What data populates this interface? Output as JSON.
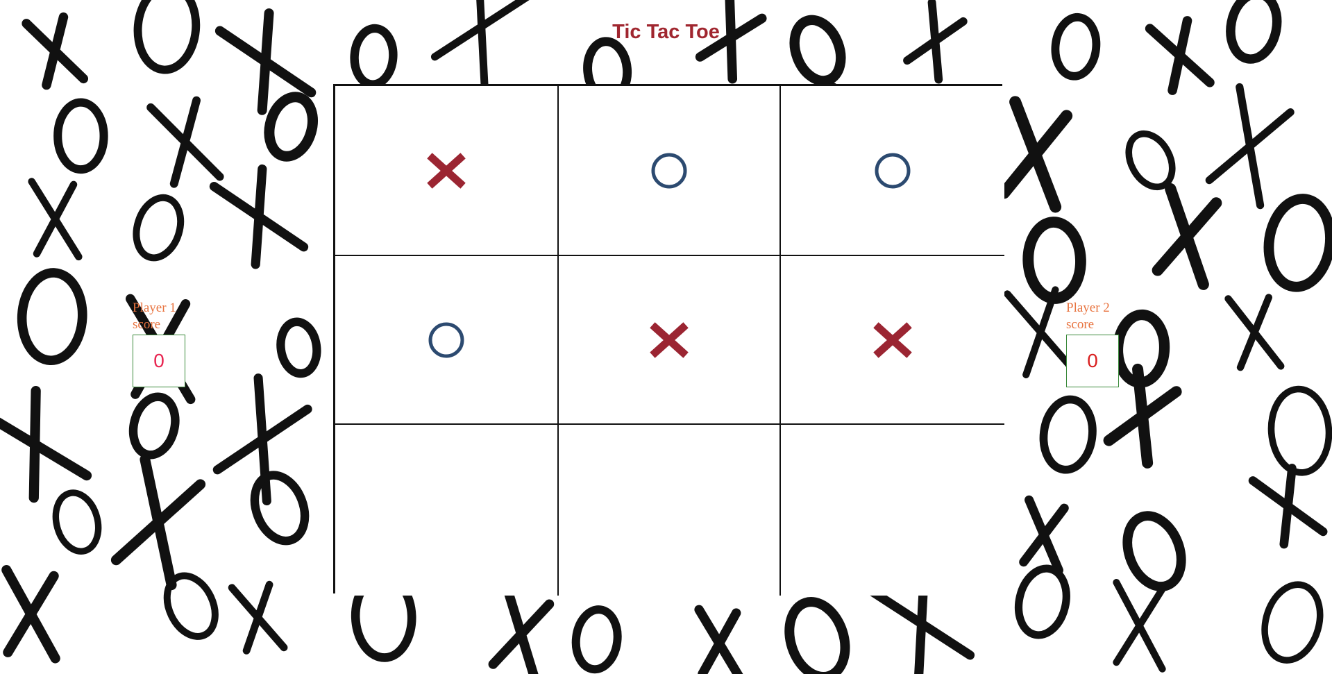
{
  "page": {
    "title": "Tic Tac Toe"
  },
  "colors": {
    "title": "#a0262f",
    "x_mark": "#9b2532",
    "o_mark": "#2c4a70",
    "score_label": "#e8733f",
    "score_value_p1": "#e8234f",
    "score_value_p2": "#d92020",
    "score_border": "#3a8a3a"
  },
  "board": {
    "cells": [
      [
        "X",
        "O",
        "O"
      ],
      [
        "O",
        "X",
        "X"
      ],
      [
        "",
        "",
        ""
      ]
    ]
  },
  "scores": {
    "player1": {
      "label": "Player 1 score",
      "value": "0"
    },
    "player2": {
      "label": "Player 2 score",
      "value": "0"
    }
  },
  "background": {
    "pattern": "brush-stroke-x-and-o"
  }
}
